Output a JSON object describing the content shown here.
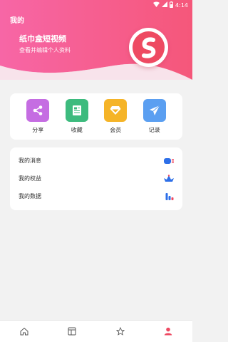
{
  "status_bar": {
    "time": "4:14"
  },
  "header": {
    "title": "我的",
    "profile_name": "纸巾盒短视频",
    "profile_subtitle": "查看并编辑个人资料"
  },
  "colors": {
    "brand_pink": "#f0577a",
    "accent_red": "#ee4a62",
    "share": "#c56de2",
    "collect": "#3dbb7e",
    "member": "#f5b428",
    "record": "#5b9ff1",
    "list_blue": "#2d6fe8"
  },
  "quick_actions": [
    {
      "label": "分享",
      "icon": "share-icon"
    },
    {
      "label": "收藏",
      "icon": "document-icon"
    },
    {
      "label": "会员",
      "icon": "diamond-icon"
    },
    {
      "label": "记录",
      "icon": "paper-plane-icon"
    }
  ],
  "menu_items": [
    {
      "label": "我的消息",
      "icon": "message-icon"
    },
    {
      "label": "我的权益",
      "icon": "crown-icon"
    },
    {
      "label": "我的数据",
      "icon": "bar-chart-icon"
    }
  ],
  "tab_bar": [
    {
      "name": "home",
      "icon": "home-icon",
      "active": false
    },
    {
      "name": "layout",
      "icon": "layout-icon",
      "active": false
    },
    {
      "name": "favorites",
      "icon": "star-icon",
      "active": false
    },
    {
      "name": "profile",
      "icon": "user-icon",
      "active": true
    }
  ]
}
